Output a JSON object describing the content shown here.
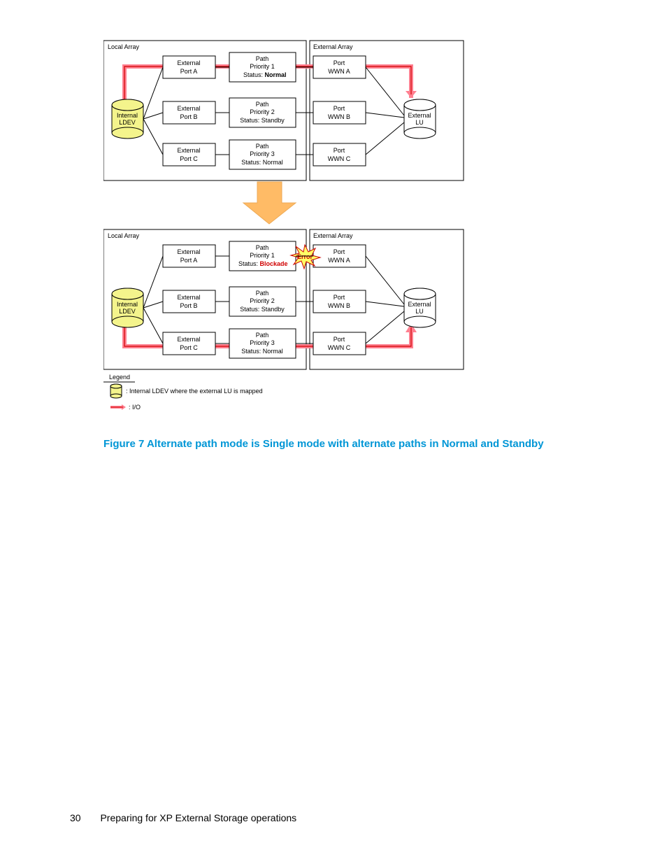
{
  "figure_caption": "Figure 7 Alternate path mode is Single mode with alternate paths in Normal and Standby",
  "page_number": "30",
  "footer_text": "Preparing for XP External Storage operations",
  "legend_title": "Legend",
  "legend_item1": ": Internal LDEV where the external LU is mapped",
  "legend_item2": ": I/O",
  "error_label": "Error",
  "top": {
    "local_array": "Local Array",
    "external_array": "External Array",
    "internal_ldev": "Internal LDEV",
    "external_lu": "External LU",
    "rows": [
      {
        "ext_port_l1": "External",
        "ext_port_l2": "Port A",
        "path_l1": "Path",
        "path_l2": "Priority 1",
        "path_l3a": "Status: ",
        "path_l3b": "Normal",
        "wwn_l1": "Port",
        "wwn_l2": "WWN A"
      },
      {
        "ext_port_l1": "External",
        "ext_port_l2": "Port B",
        "path_l1": "Path",
        "path_l2": "Priority 2",
        "path_l3a": "Status: Standby",
        "path_l3b": "",
        "wwn_l1": "Port",
        "wwn_l2": "WWN B"
      },
      {
        "ext_port_l1": "External",
        "ext_port_l2": "Port C",
        "path_l1": "Path",
        "path_l2": "Priority 3",
        "path_l3a": "Status: Normal",
        "path_l3b": "",
        "wwn_l1": "Port",
        "wwn_l2": "WWN C"
      }
    ]
  },
  "bot": {
    "local_array": "Local Array",
    "external_array": "External Array",
    "internal_ldev": "Internal LDEV",
    "external_lu": "External LU",
    "rows": [
      {
        "ext_port_l1": "External",
        "ext_port_l2": "Port A",
        "path_l1": "Path",
        "path_l2": "Priority 1",
        "path_l3a": "Status: ",
        "path_l3b": "Blockade",
        "wwn_l1": "Port",
        "wwn_l2": "WWN A"
      },
      {
        "ext_port_l1": "External",
        "ext_port_l2": "Port B",
        "path_l1": "Path",
        "path_l2": "Priority 2",
        "path_l3a": "Status: Standby",
        "path_l3b": "",
        "wwn_l1": "Port",
        "wwn_l2": "WWN B"
      },
      {
        "ext_port_l1": "External",
        "ext_port_l2": "Port C",
        "path_l1": "Path",
        "path_l2": "Priority 3",
        "path_l3a": "Status: Normal",
        "path_l3b": "",
        "wwn_l1": "Port",
        "wwn_l2": "WWN C"
      }
    ]
  }
}
